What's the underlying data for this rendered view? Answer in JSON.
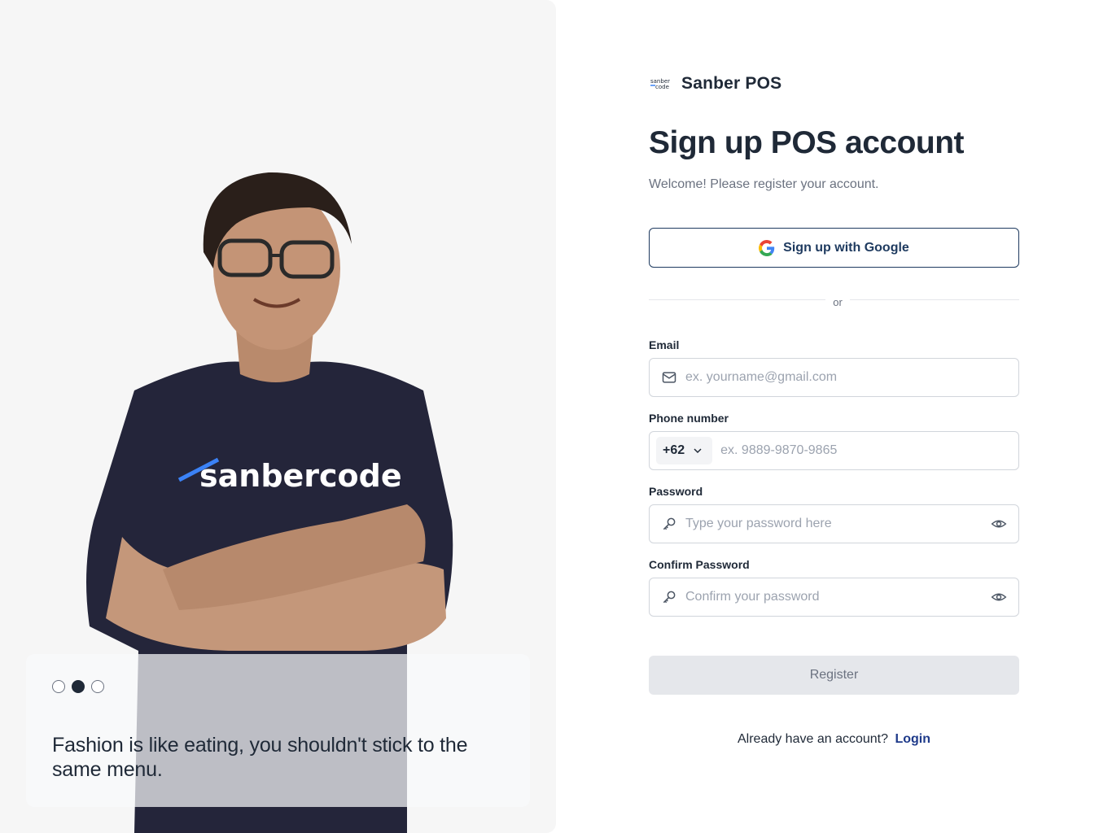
{
  "hero": {
    "carousel_total": 3,
    "carousel_active": 2,
    "quote": "Fashion is like eating, you shouldn't stick to the same menu.",
    "shirt_text": "sanbercode"
  },
  "brand": {
    "logo_text": "sanber code",
    "name": "Sanber POS"
  },
  "form": {
    "title": "Sign up POS account",
    "subtitle": "Welcome! Please register your account.",
    "google_label": "Sign up with Google",
    "divider": "or",
    "email": {
      "label": "Email",
      "placeholder": "ex. yourname@gmail.com",
      "value": ""
    },
    "phone": {
      "label": "Phone number",
      "country_code": "+62",
      "placeholder": "ex. 9889-9870-9865",
      "value": ""
    },
    "password": {
      "label": "Password",
      "placeholder": "Type your password here",
      "value": ""
    },
    "confirm_password": {
      "label": "Confirm Password",
      "placeholder": "Confirm your password",
      "value": ""
    },
    "register_label": "Register",
    "login_prompt": "Already have an account?",
    "login_link": "Login"
  },
  "colors": {
    "primary": "#1e3a5f",
    "link": "#1e3a8a",
    "text": "#1f2937",
    "muted": "#6b7280",
    "disabled_button": "#e5e7eb"
  }
}
